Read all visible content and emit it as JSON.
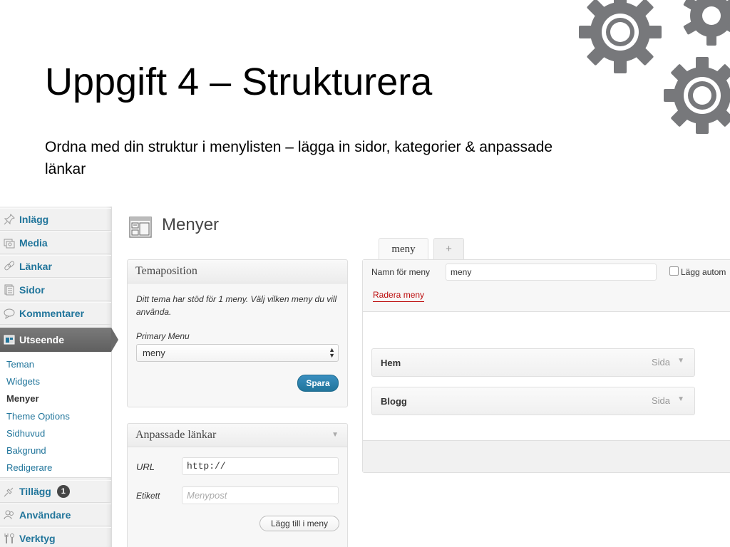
{
  "slide": {
    "title": "Uppgift 4 – Strukturera",
    "subtitle": "Ordna med din struktur i menylisten – lägga in sidor, kategorier & anpassade länkar"
  },
  "sidebar": {
    "items": [
      {
        "label": "Inlägg",
        "icon": "pushpin-icon"
      },
      {
        "label": "Media",
        "icon": "media-icon"
      },
      {
        "label": "Länkar",
        "icon": "link-icon"
      },
      {
        "label": "Sidor",
        "icon": "pages-icon"
      },
      {
        "label": "Kommentarer",
        "icon": "comment-icon"
      },
      {
        "label": "Utseende",
        "icon": "appearance-icon"
      },
      {
        "label": "Tillägg",
        "icon": "plugin-icon",
        "badge": "1"
      },
      {
        "label": "Användare",
        "icon": "users-icon"
      },
      {
        "label": "Verktyg",
        "icon": "tools-icon"
      }
    ],
    "submenu": [
      "Teman",
      "Widgets",
      "Menyer",
      "Theme Options",
      "Sidhuvud",
      "Bakgrund",
      "Redigerare"
    ]
  },
  "page": {
    "title": "Menyer"
  },
  "theme_position": {
    "heading": "Temaposition",
    "description": "Ditt tema har stöd för 1 meny. Välj vilken meny du vill använda.",
    "primary_label": "Primary Menu",
    "selected": "meny",
    "save_label": "Spara"
  },
  "custom_links": {
    "heading": "Anpassade länkar",
    "url_label": "URL",
    "url_value": "http://",
    "label_label": "Etikett",
    "label_placeholder": "Menypost",
    "add_label": "Lägg till i meny"
  },
  "tabs": [
    {
      "label": "meny",
      "active": true
    },
    {
      "label": "+",
      "active": false
    }
  ],
  "editor": {
    "name_label": "Namn för meny",
    "name_value": "meny",
    "auto_add_label": "Lägg autom",
    "delete_label": "Radera meny",
    "items": [
      {
        "title": "Hem",
        "type": "Sida"
      },
      {
        "title": "Blogg",
        "type": "Sida"
      }
    ]
  },
  "colors": {
    "accent": "#21759b",
    "gears": "#77787b",
    "delete": "#bc0b0b"
  }
}
